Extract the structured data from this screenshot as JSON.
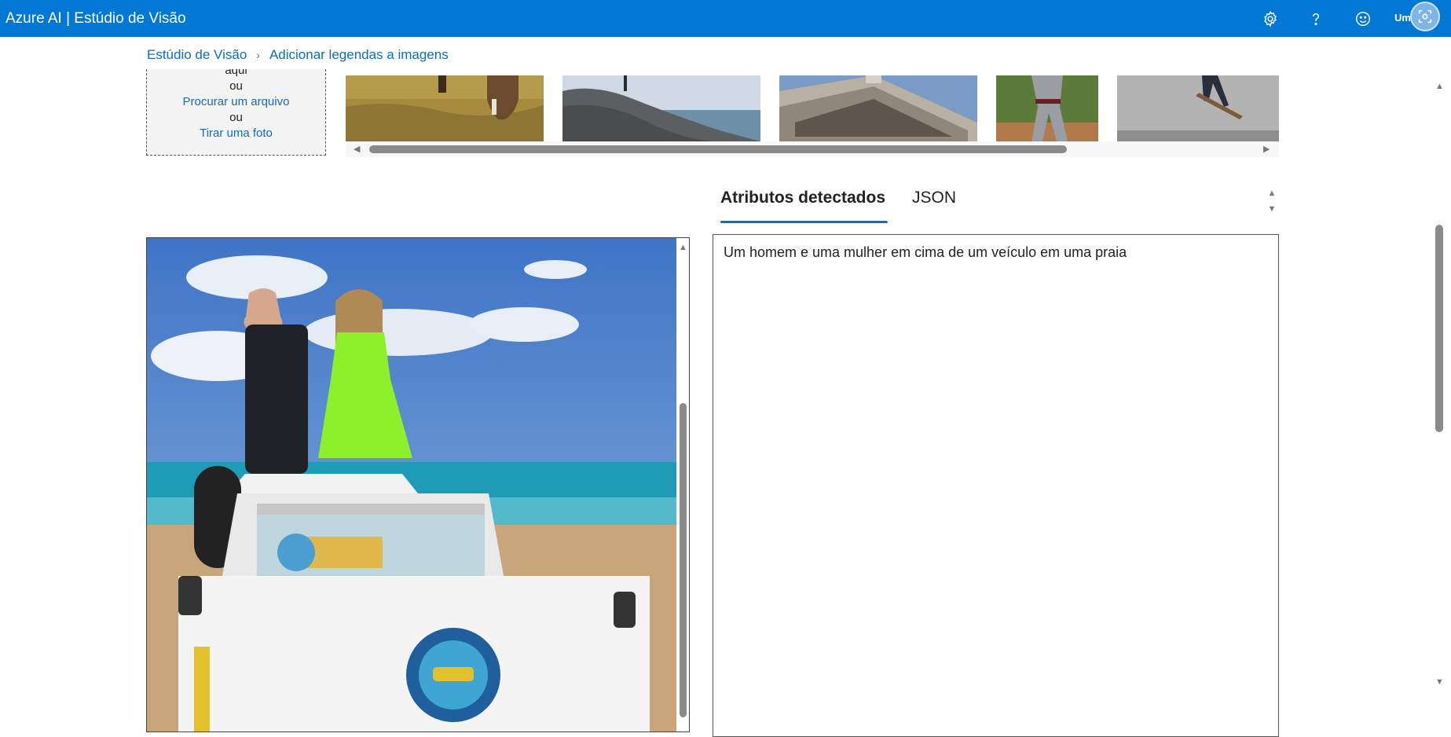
{
  "header": {
    "app_title": "Azure AI | Estúdio de Visão",
    "user_initials": "Um",
    "icons": [
      "gear-icon",
      "help-icon",
      "feedback-smiley-icon",
      "screenshot-capture-icon"
    ]
  },
  "breadcrumb": {
    "root": "Estúdio de Visão",
    "current": "Adicionar legendas a imagens"
  },
  "upload": {
    "line_partial": "aqui",
    "or_1": "ou",
    "browse_link": "Procurar um arquivo",
    "or_2": "ou",
    "camera_link": "Tirar uma foto"
  },
  "tabs": {
    "items": [
      "Atributos detectados",
      "JSON"
    ],
    "selected": "Atributos detectados"
  },
  "result": {
    "caption": "Um homem e uma mulher em cima de um veículo em uma praia"
  },
  "colors": {
    "header": "#0078d4",
    "link": "#0f6cbd",
    "tab_underline": "#0f6cbd"
  }
}
